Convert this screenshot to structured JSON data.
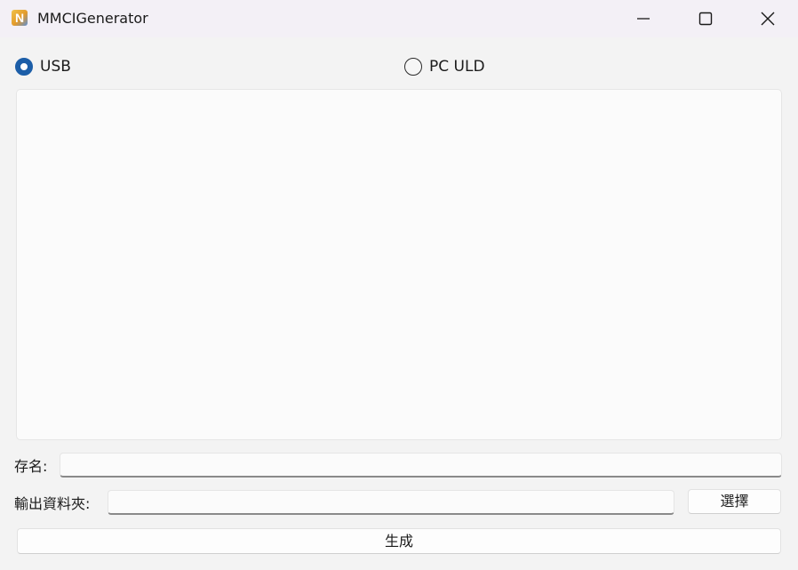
{
  "window": {
    "title": "MMCIGenerator",
    "app_icon_letter": "N"
  },
  "mode": {
    "options": [
      {
        "label": "USB",
        "checked": true
      },
      {
        "label": "PC ULD",
        "checked": false
      }
    ]
  },
  "log_area": {
    "value": ""
  },
  "save_name": {
    "label": "存名:",
    "value": ""
  },
  "output_folder": {
    "label": "輸出資料夾:",
    "value": "",
    "select_button": "選擇"
  },
  "generate_button": "生成",
  "colors": {
    "accent": "#1c5ea8",
    "window_bg": "#f3f3f3",
    "titlebar_bg": "#f3f0f6"
  },
  "icons": [
    "app-icon",
    "minimize-icon",
    "maximize-icon",
    "close-icon"
  ]
}
